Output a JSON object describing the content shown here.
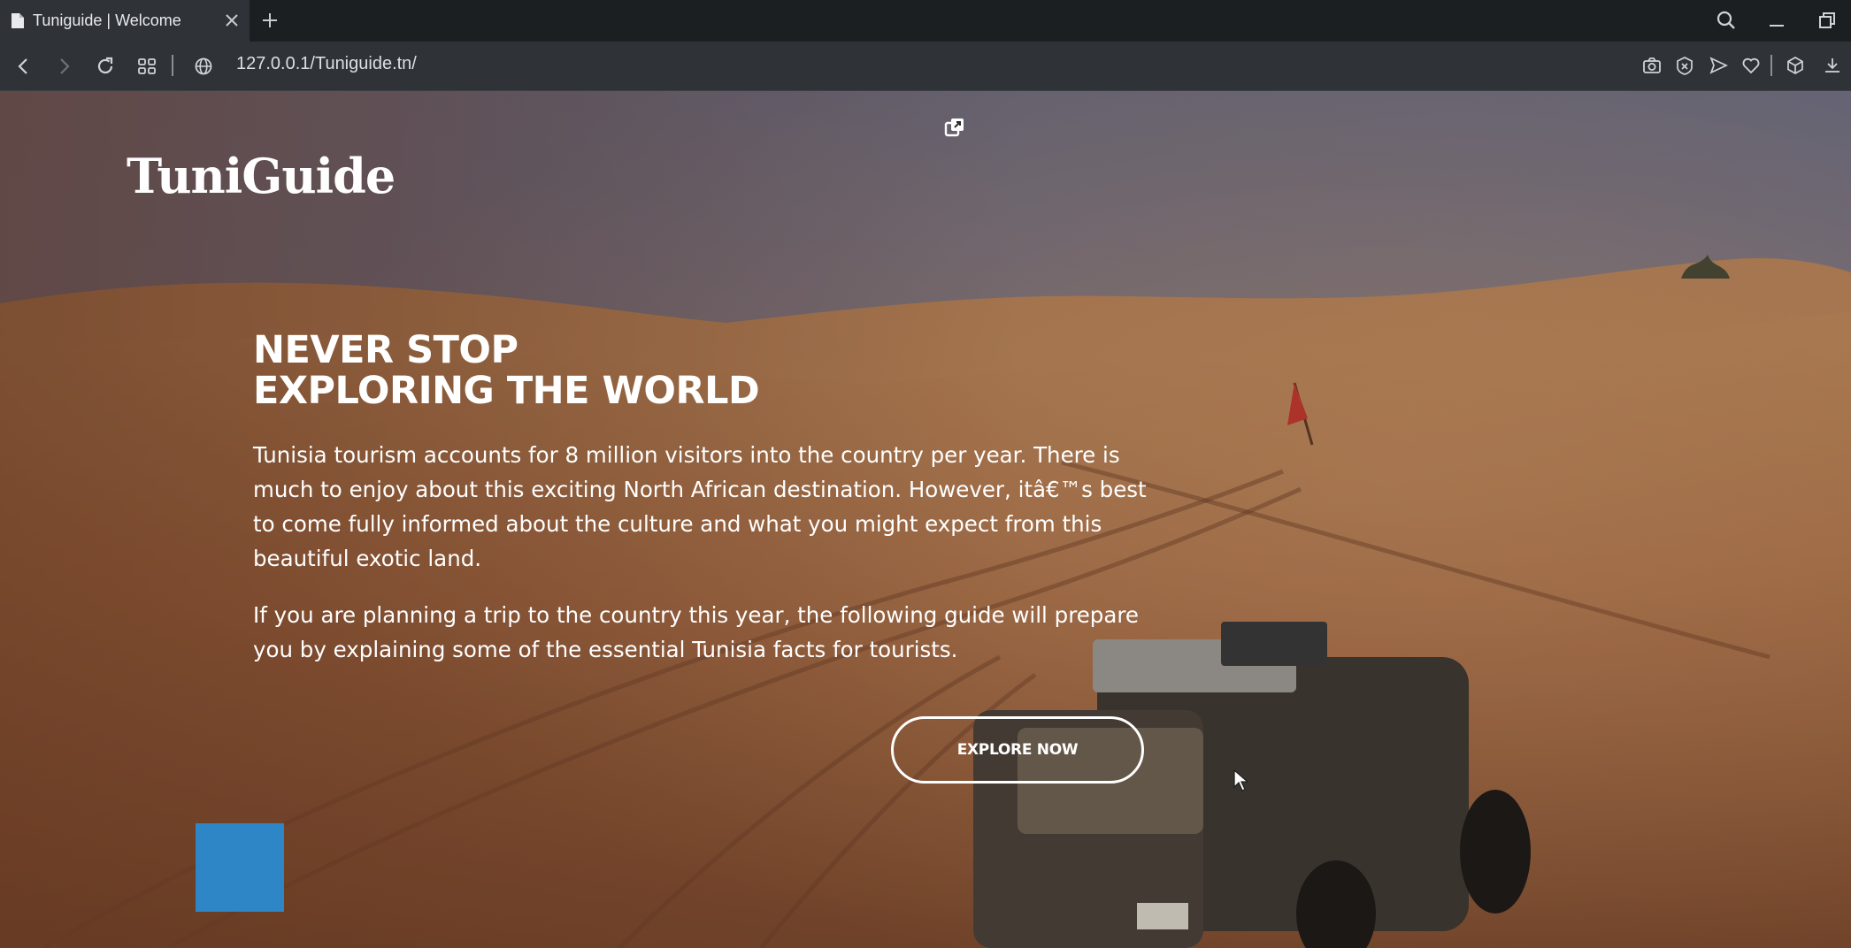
{
  "browser": {
    "tab": {
      "title": "Tuniguide | Welcome",
      "icon": "document-icon"
    },
    "address_bar": {
      "url": "127.0.0.1/Tuniguide.tn/"
    },
    "icons": [
      "back-arrow-icon",
      "forward-arrow-icon",
      "reload-icon",
      "grid-icon",
      "globe-icon",
      "camera-icon",
      "block-icon",
      "send-icon",
      "heart-icon",
      "cube-icon",
      "download-icon",
      "search-icon",
      "minimize-icon",
      "restore-icon",
      "close-icon",
      "plus-icon"
    ]
  },
  "page": {
    "brand": "TuniGuide",
    "headline": {
      "line1": "NEVER STOP",
      "line2": "EXPLORING THE WORLD"
    },
    "paragraph1": "Tunisia tourism accounts for 8 million visitors into the country per year. There is much to enjoy about this exciting North African destination. However, itâ€™s best to come fully informed about the culture and what you might expect from this beautiful exotic land.",
    "paragraph2": "If you are planning a trip to the country this year, the following guide will prepare you by explaining some of the essential Tunisia facts for tourists.",
    "cta_label": "EXPLORE NOW",
    "accent_square_color": "#2f86c6",
    "background": "desert dunes with off-road vehicle"
  }
}
